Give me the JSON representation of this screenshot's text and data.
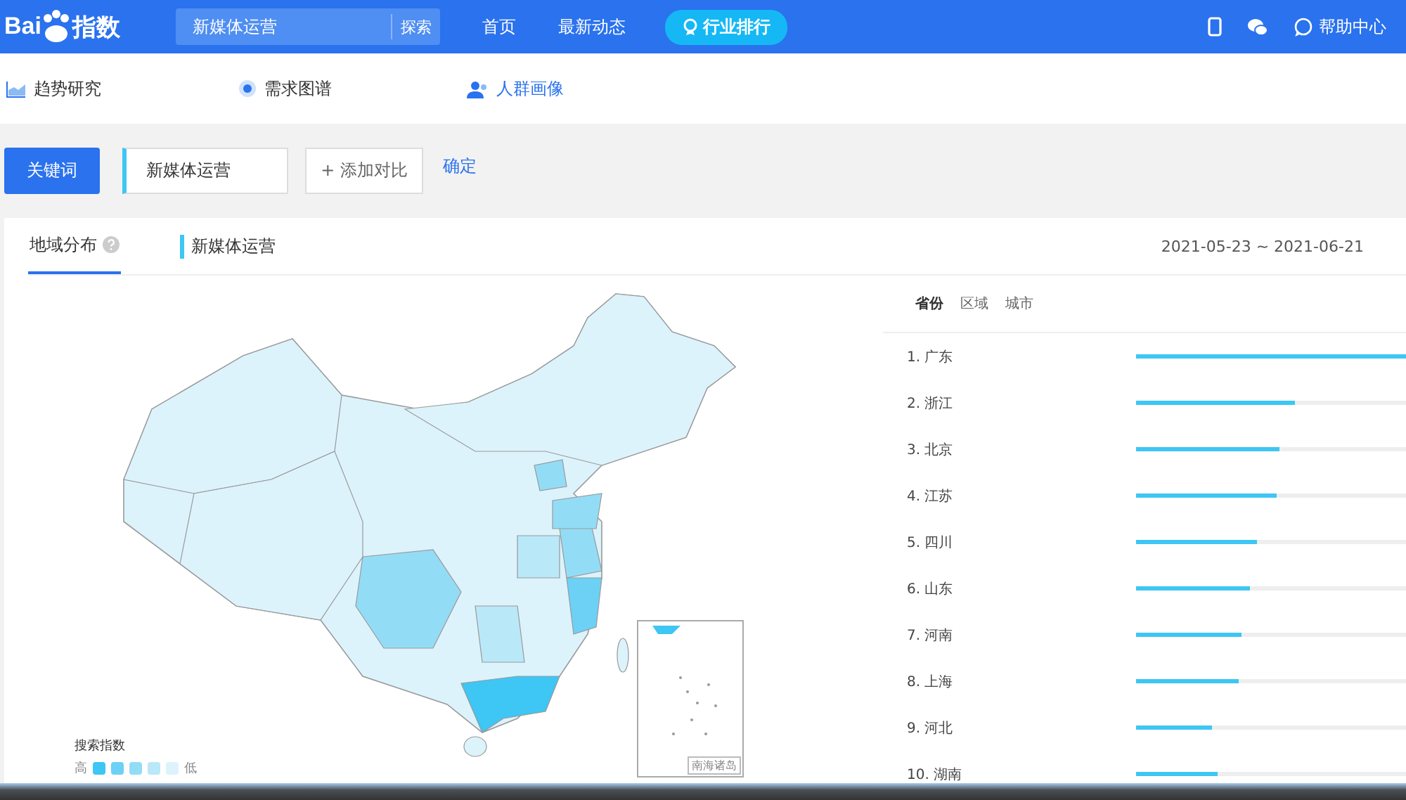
{
  "header": {
    "logo": {
      "left": "Bai",
      "right": "指数"
    },
    "search": {
      "value": "新媒体运营",
      "button": "探索"
    },
    "nav": [
      {
        "label": "首页",
        "kind": "link"
      },
      {
        "label": "最新动态",
        "kind": "link"
      },
      {
        "label": "行业排行",
        "kind": "pill"
      }
    ],
    "help": "帮助中心"
  },
  "subnav": [
    {
      "label": "趋势研究",
      "kind": "trend",
      "selected": false
    },
    {
      "label": "需求图谱",
      "kind": "demand",
      "selected": false
    },
    {
      "label": "人群画像",
      "kind": "crowd",
      "selected": true
    }
  ],
  "keyword_bar": {
    "tab": "关键词",
    "keyword": "新媒体运营",
    "add": "+ 添加对比",
    "confirm": "确定"
  },
  "panel": {
    "tab": "地域分布",
    "series": "新媒体运营",
    "date_range": "2021-05-23 ~ 2021-06-21",
    "legend": {
      "title": "搜索指数",
      "high": "高",
      "low": "低"
    },
    "inset_label": "南海诸岛",
    "ranking_tabs": [
      {
        "label": "省份",
        "selected": true
      },
      {
        "label": "区域",
        "selected": false
      },
      {
        "label": "城市",
        "selected": false
      }
    ],
    "ranking": [
      {
        "rank": "1.",
        "name": "广东",
        "level": 1.0
      },
      {
        "rank": "2.",
        "name": "浙江",
        "level": 0.59
      },
      {
        "rank": "3.",
        "name": "北京",
        "level": 0.53
      },
      {
        "rank": "4.",
        "name": "江苏",
        "level": 0.52
      },
      {
        "rank": "5.",
        "name": "四川",
        "level": 0.45
      },
      {
        "rank": "6.",
        "name": "山东",
        "level": 0.42
      },
      {
        "rank": "7.",
        "name": "河南",
        "level": 0.39
      },
      {
        "rank": "8.",
        "name": "上海",
        "level": 0.38
      },
      {
        "rank": "9.",
        "name": "河北",
        "level": 0.28
      },
      {
        "rank": "10.",
        "name": "湖南",
        "level": 0.3
      }
    ]
  }
}
